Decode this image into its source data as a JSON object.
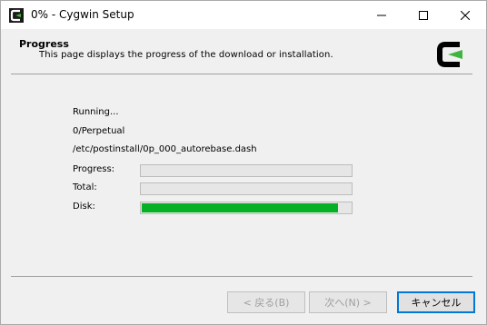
{
  "window": {
    "title": "0% - Cygwin Setup"
  },
  "header": {
    "title": "Progress",
    "subtitle": "This page displays the progress of the download or installation."
  },
  "status": {
    "line1": "Running...",
    "line2": "0/Perpetual",
    "line3": "/etc/postinstall/0p_000_autorebase.dash"
  },
  "progress": {
    "progress_label": "Progress:",
    "progress_value": 0,
    "total_label": "Total:",
    "total_value": 0,
    "disk_label": "Disk:",
    "disk_value": 0.94
  },
  "buttons": {
    "back": "< 戻る(B)",
    "next": "次へ(N) >",
    "cancel": "キャンセル"
  },
  "colors": {
    "progress_fill": "#06b025",
    "accent": "#0078d7"
  }
}
